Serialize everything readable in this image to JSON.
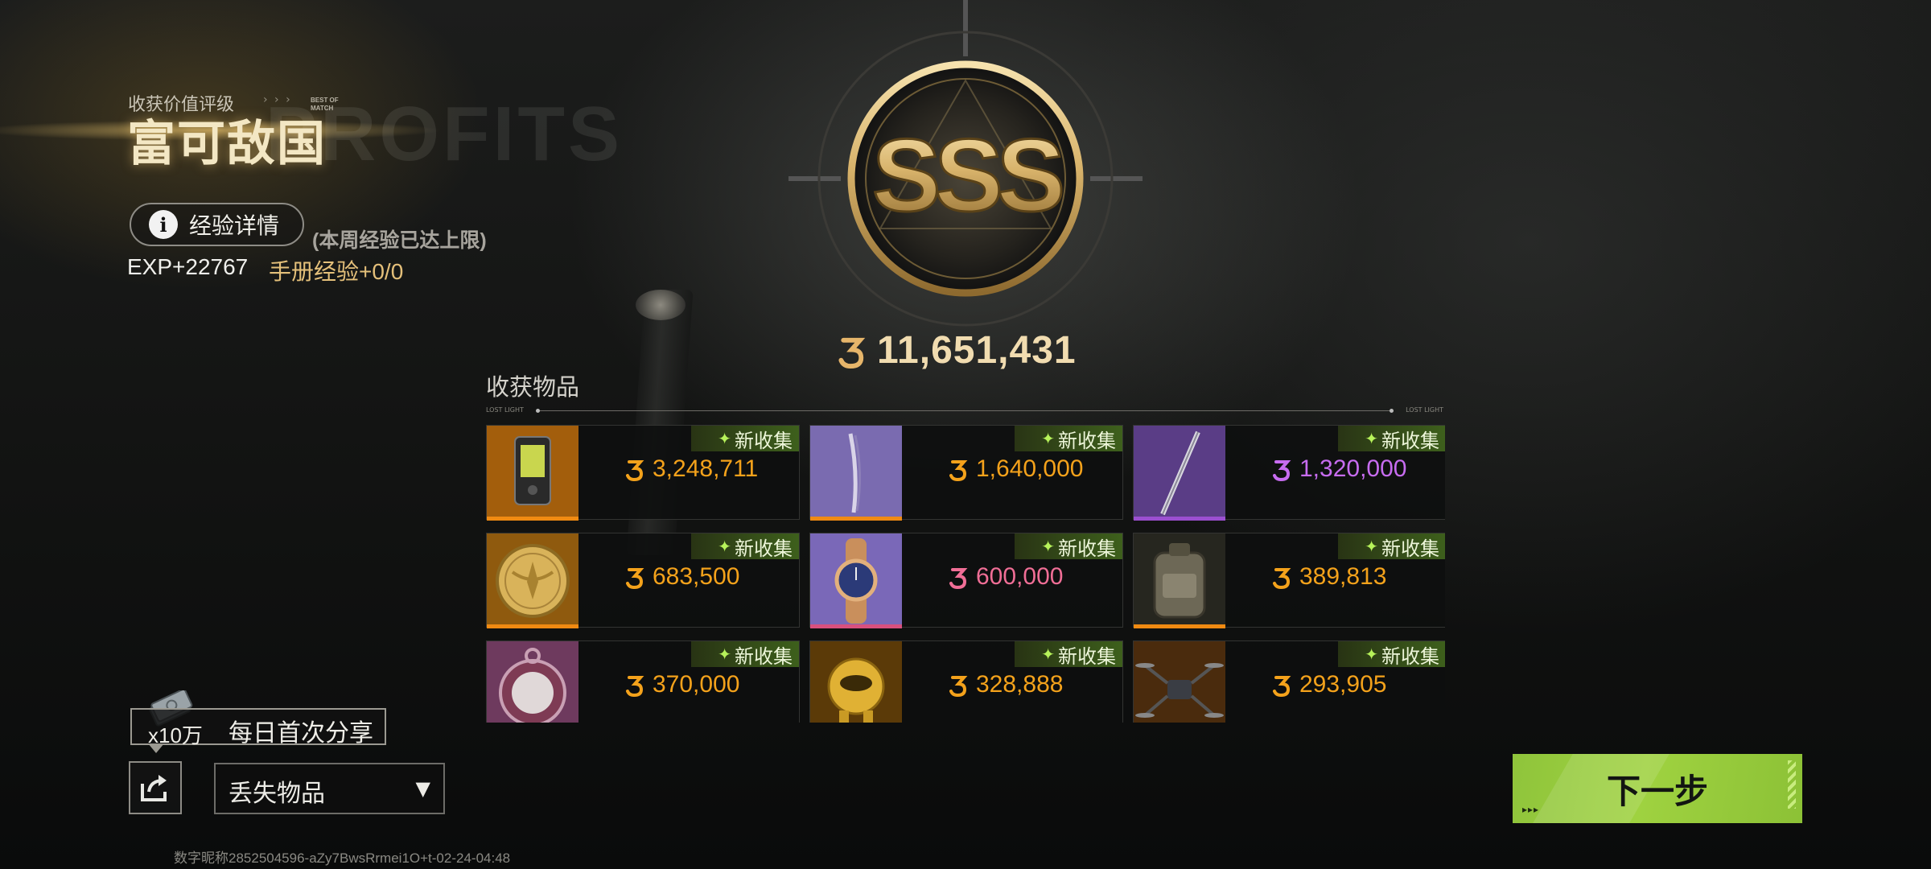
{
  "header": {
    "rating_label": "收获价值评级",
    "rating_title": "富可敌国",
    "best_of_match": "BEST OF MATCH",
    "watermark": "PROFITS"
  },
  "experience": {
    "detail_button_label": "经验详情",
    "weekly_cap_note": "(本周经验已达上限)",
    "exp_gain": "EXP+22767",
    "manual_exp": "手册经验+0/0"
  },
  "grade": {
    "rank": "SSS",
    "total_value": "11,651,431"
  },
  "collection": {
    "title": "收获物品",
    "items": [
      {
        "value": "3,248,711",
        "badge": "新收集",
        "value_color": "#f4a21b",
        "rarity_color": "#f08a12",
        "icon": "gadget-icon",
        "thumb_bg": "#a35e0c"
      },
      {
        "value": "1,640,000",
        "badge": "新收集",
        "value_color": "#f4a21b",
        "rarity_color": "#f08a12",
        "icon": "blade-icon",
        "thumb_bg": "#7a6bb0"
      },
      {
        "value": "1,320,000",
        "badge": "新收集",
        "value_color": "#c76cf0",
        "rarity_color": "#9b4fd0",
        "icon": "spear-icon",
        "thumb_bg": "#5a3d86"
      },
      {
        "value": "683,500",
        "badge": "新收集",
        "value_color": "#f4a21b",
        "rarity_color": "#f08a12",
        "icon": "gold-coin-icon",
        "thumb_bg": "#8f5a0e"
      },
      {
        "value": "600,000",
        "badge": "新收集",
        "value_color": "#f06e96",
        "rarity_color": "#d8507e",
        "icon": "watch-icon",
        "thumb_bg": "#7a68b8"
      },
      {
        "value": "389,813",
        "badge": "新收集",
        "value_color": "#f4a21b",
        "rarity_color": "#f08a12",
        "icon": "backpack-icon",
        "thumb_bg": "#26261f"
      },
      {
        "value": "370,000",
        "badge": "新收集",
        "value_color": "#f4a21b",
        "rarity_color": "#f08a12",
        "icon": "pocket-watch-icon",
        "thumb_bg": "#6e3a5e"
      },
      {
        "value": "328,888",
        "badge": "新收集",
        "value_color": "#f4a21b",
        "rarity_color": "#f08a12",
        "icon": "golden-robot-icon",
        "thumb_bg": "#5b3a08"
      },
      {
        "value": "293,905",
        "badge": "新收集",
        "value_color": "#f4a21b",
        "rarity_color": "#f08a12",
        "icon": "drone-icon",
        "thumb_bg": "#4a2b0d"
      }
    ]
  },
  "share": {
    "reward_qty": "x10万",
    "label": "每日首次分享"
  },
  "lost_items": {
    "selected": "丢失物品"
  },
  "footer": {
    "id_text": "数字昵称2852504596-aZy7BwsRrmei1O+t-02-24-04:48"
  },
  "next_button": {
    "label": "下一步"
  },
  "colors": {
    "accent_green": "#9fd240",
    "gold": "#c9a55a",
    "new_badge": "#6e9a2a"
  }
}
